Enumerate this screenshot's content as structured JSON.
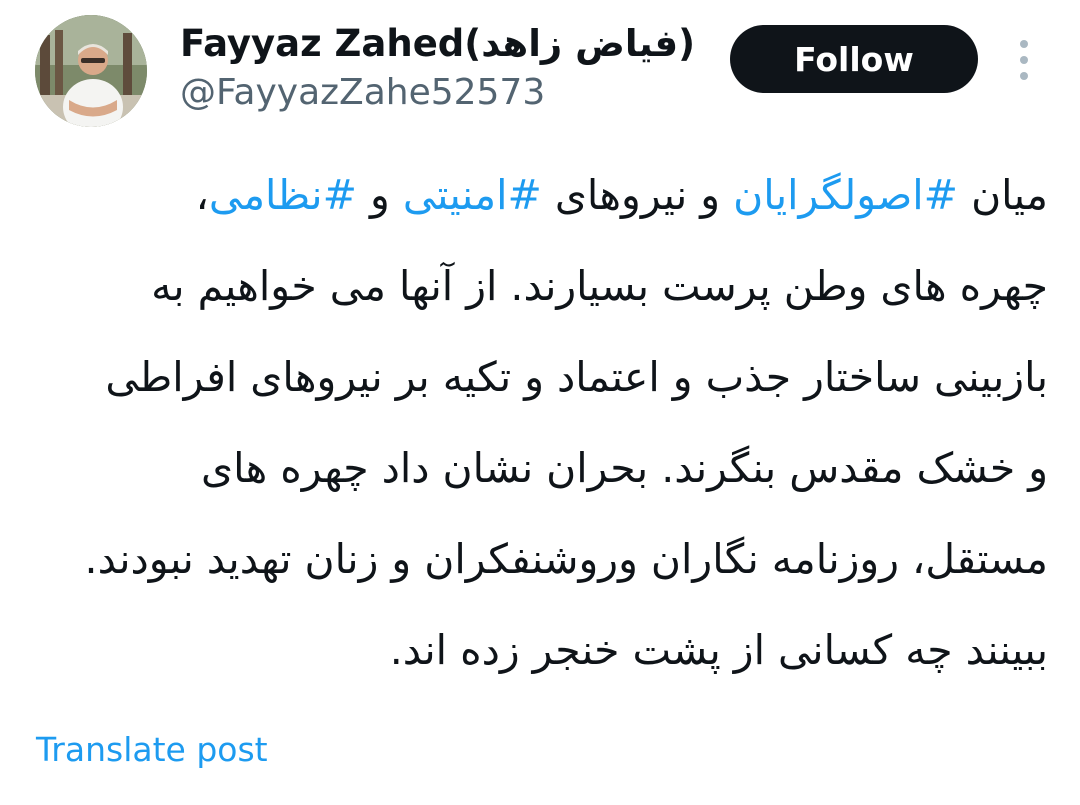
{
  "author": {
    "display_name": "Fayyaz Zahed(فیاض زاهد)",
    "handle": "@FayyazZahe52573",
    "avatar_icon": "profile-photo"
  },
  "actions": {
    "follow_label": "Follow",
    "more_icon": "vertical-ellipsis-icon"
  },
  "post": {
    "line1": {
      "w1": "میان ",
      "tag1": "#اصولگرایان",
      "w2": " و نیروهای ",
      "tag2": "#امنیتی",
      "w3": " و ",
      "tag3": "#نظامی",
      "w4": "،"
    },
    "line2": "چهره های وطن پرست بسیارند. از آنها می خواهیم به",
    "line3": "بازبینی ساختار جذب و اعتماد و تکیه بر نیروهای افراطی",
    "line4": "و خشک مقدس بنگرند. بحران نشان داد چهره های",
    "line5": "مستقل، روزنامه نگاران وروشنفکران و زنان تهدید نبودند.",
    "line6": "ببینند چه کسانی از پشت خنجر زده اند."
  },
  "translate_label": "Translate post",
  "colors": {
    "link": "#1d9bf0",
    "text": "#0f1419",
    "secondary": "#536471",
    "button_bg": "#0f1419"
  }
}
